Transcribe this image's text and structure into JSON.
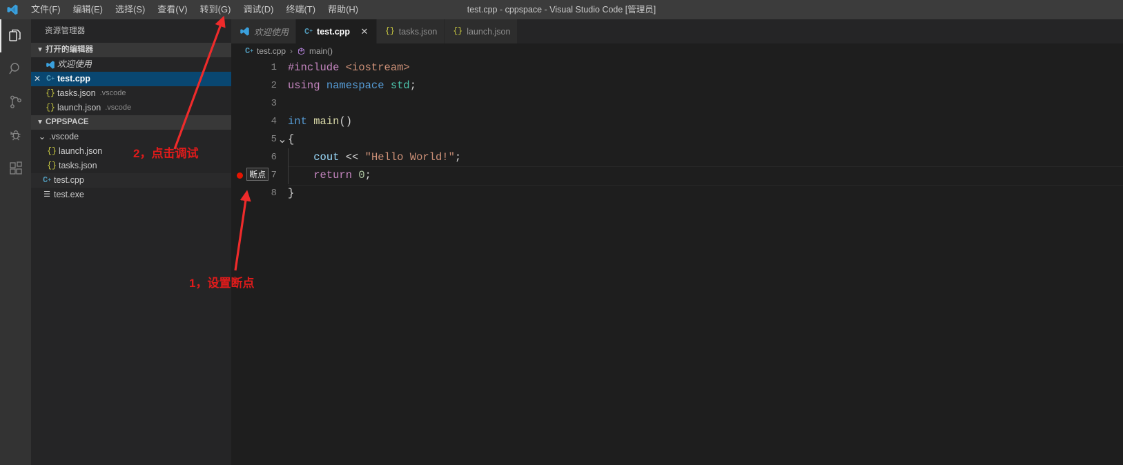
{
  "window": {
    "title": "test.cpp - cppspace - Visual Studio Code [管理员]",
    "logo_icon": "vscode-logo-icon"
  },
  "menubar": {
    "items": [
      {
        "label": "文件(F)",
        "name": "menu-file"
      },
      {
        "label": "编辑(E)",
        "name": "menu-edit"
      },
      {
        "label": "选择(S)",
        "name": "menu-selection"
      },
      {
        "label": "查看(V)",
        "name": "menu-view"
      },
      {
        "label": "转到(G)",
        "name": "menu-go"
      },
      {
        "label": "调试(D)",
        "name": "menu-debug"
      },
      {
        "label": "终端(T)",
        "name": "menu-terminal"
      },
      {
        "label": "帮助(H)",
        "name": "menu-help"
      }
    ]
  },
  "activitybar": {
    "items": [
      {
        "icon": "explorer-files-icon",
        "name": "activity-explorer",
        "active": true
      },
      {
        "icon": "search-icon",
        "name": "activity-search",
        "active": false
      },
      {
        "icon": "source-control-branch-icon",
        "name": "activity-source-control",
        "active": false
      },
      {
        "icon": "run-debug-bug-icon",
        "name": "activity-run-debug",
        "active": false
      },
      {
        "icon": "extensions-blocks-icon",
        "name": "activity-extensions",
        "active": false
      }
    ]
  },
  "sidebar": {
    "title": "资源管理器",
    "open_editors": {
      "header": "打开的编辑器",
      "chevron": "▾",
      "items": [
        {
          "label": "欢迎使用",
          "icon": "vscode-logo-icon",
          "desc": "",
          "selected": false,
          "italic": true,
          "closable": false
        },
        {
          "label": "test.cpp",
          "icon": "cpp-file-icon",
          "desc": "",
          "selected": true,
          "italic": false,
          "closable": true
        },
        {
          "label": "tasks.json",
          "icon": "json-file-icon",
          "desc": ".vscode",
          "selected": false,
          "italic": false,
          "closable": false
        },
        {
          "label": "launch.json",
          "icon": "json-file-icon",
          "desc": ".vscode",
          "selected": false,
          "italic": false,
          "closable": false
        }
      ]
    },
    "workspace": {
      "header": "CPPSPACE",
      "chevron": "▾",
      "items": [
        {
          "label": ".vscode",
          "icon": "folder-chevron-icon",
          "indent": 1,
          "selected": false
        },
        {
          "label": "launch.json",
          "icon": "json-file-icon",
          "indent": 2,
          "selected": false
        },
        {
          "label": "tasks.json",
          "icon": "json-file-icon",
          "indent": 2,
          "selected": false
        },
        {
          "label": "test.cpp",
          "icon": "cpp-file-icon",
          "indent": 1,
          "selected": true
        },
        {
          "label": "test.exe",
          "icon": "exe-file-icon",
          "indent": 1,
          "selected": false
        }
      ]
    }
  },
  "editor": {
    "tabs": [
      {
        "label": "欢迎使用",
        "icon": "vscode-logo-icon",
        "active": false,
        "italic": true,
        "closable": false
      },
      {
        "label": "test.cpp",
        "icon": "cpp-file-icon",
        "active": true,
        "italic": false,
        "closable": true,
        "close_glyph": "✕"
      },
      {
        "label": "tasks.json",
        "icon": "json-file-icon",
        "active": false,
        "italic": false,
        "closable": false
      },
      {
        "label": "launch.json",
        "icon": "json-file-icon",
        "active": false,
        "italic": false,
        "closable": false
      }
    ],
    "breadcrumb": {
      "file": "test.cpp",
      "file_icon": "cpp-file-icon",
      "separator": "›",
      "symbol": "main()",
      "symbol_icon": "symbol-method-icon"
    },
    "code": {
      "lines": [
        {
          "no": "1",
          "fold": "",
          "breakpoint": false,
          "current": false,
          "indent_guide": false,
          "tokens": [
            {
              "t": "#include ",
              "c": "t-pre"
            },
            {
              "t": "<iostream>",
              "c": "t-str"
            }
          ]
        },
        {
          "no": "2",
          "fold": "",
          "breakpoint": false,
          "current": false,
          "indent_guide": false,
          "tokens": [
            {
              "t": "using ",
              "c": "t-ctrl"
            },
            {
              "t": "namespace ",
              "c": "t-kw"
            },
            {
              "t": "std",
              "c": "t-ns"
            },
            {
              "t": ";",
              "c": "t-plain"
            }
          ]
        },
        {
          "no": "3",
          "fold": "",
          "breakpoint": false,
          "current": false,
          "indent_guide": false,
          "tokens": []
        },
        {
          "no": "4",
          "fold": "",
          "breakpoint": false,
          "current": false,
          "indent_guide": false,
          "tokens": [
            {
              "t": "int ",
              "c": "t-kw"
            },
            {
              "t": "main",
              "c": "t-fn"
            },
            {
              "t": "()",
              "c": "t-plain"
            }
          ]
        },
        {
          "no": "5",
          "fold": "⌄",
          "breakpoint": false,
          "current": false,
          "indent_guide": false,
          "tokens": [
            {
              "t": "{",
              "c": "t-plain"
            }
          ]
        },
        {
          "no": "6",
          "fold": "",
          "breakpoint": false,
          "current": false,
          "indent_guide": true,
          "tokens": [
            {
              "t": "    ",
              "c": "t-plain"
            },
            {
              "t": "cout",
              "c": "t-var"
            },
            {
              "t": " << ",
              "c": "t-plain"
            },
            {
              "t": "\"Hello World!\"",
              "c": "t-str"
            },
            {
              "t": ";",
              "c": "t-plain"
            }
          ]
        },
        {
          "no": "7",
          "fold": "",
          "breakpoint": true,
          "current": true,
          "indent_guide": true,
          "tokens": [
            {
              "t": "    ",
              "c": "t-plain"
            },
            {
              "t": "return ",
              "c": "t-ctrl"
            },
            {
              "t": "0",
              "c": "t-num"
            },
            {
              "t": ";",
              "c": "t-plain"
            }
          ]
        },
        {
          "no": "8",
          "fold": "",
          "breakpoint": false,
          "current": false,
          "indent_guide": false,
          "tokens": [
            {
              "t": "}",
              "c": "t-plain"
            }
          ]
        }
      ]
    }
  },
  "annotations": {
    "breakpoint_tooltip": "断点",
    "step2": "2，点击调试",
    "step1": "1，设置断点",
    "arrow_color": "#ef2b2b",
    "text_color": "#e01b1b"
  }
}
